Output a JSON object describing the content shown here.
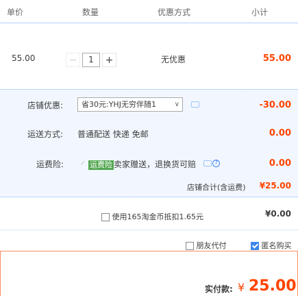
{
  "header": {
    "col_price": "单价",
    "col_qty": "数量",
    "col_promo": "优惠方式",
    "col_subtotal": "小计"
  },
  "item": {
    "price": "55.00",
    "minus_label": "−",
    "quantity": "1",
    "plus_label": "+",
    "promo": "无优惠",
    "subtotal": "55.00"
  },
  "shop": {
    "discount_label": "店铺优惠:",
    "discount_select": "省30元:YHJ无穷伴随1",
    "discount_arrow": "∨",
    "discount_amount": "-30.00",
    "shipping_label": "运送方式:",
    "shipping_value": "普通配送 快递 免邮",
    "shipping_amount": "0.00",
    "insurance_label": "运费险:",
    "insurance_check": "✓",
    "insurance_tag": "运费险",
    "insurance_text": "卖家赠送，退换货可赔",
    "insurance_help": "?",
    "insurance_amount": "0.00",
    "total_label": "店铺合计(含运费)",
    "total_value": "¥25.00"
  },
  "coins": {
    "label": "使用165淘金币抵扣1.65元",
    "amount": "¥0.00",
    "checked": false
  },
  "options": {
    "friend_pay": "朋友代付",
    "friend_pay_checked": false,
    "anonymous": "匿名购买",
    "anonymous_checked": true
  },
  "summary": {
    "label": "实付款:",
    "currency": "¥",
    "amount": "25.00"
  },
  "colors": {
    "accent_red": "#ff4400",
    "accent_blue": "#3b86ec",
    "panel_bg": "#f2f7ff",
    "tag_green": "#52a64f"
  }
}
